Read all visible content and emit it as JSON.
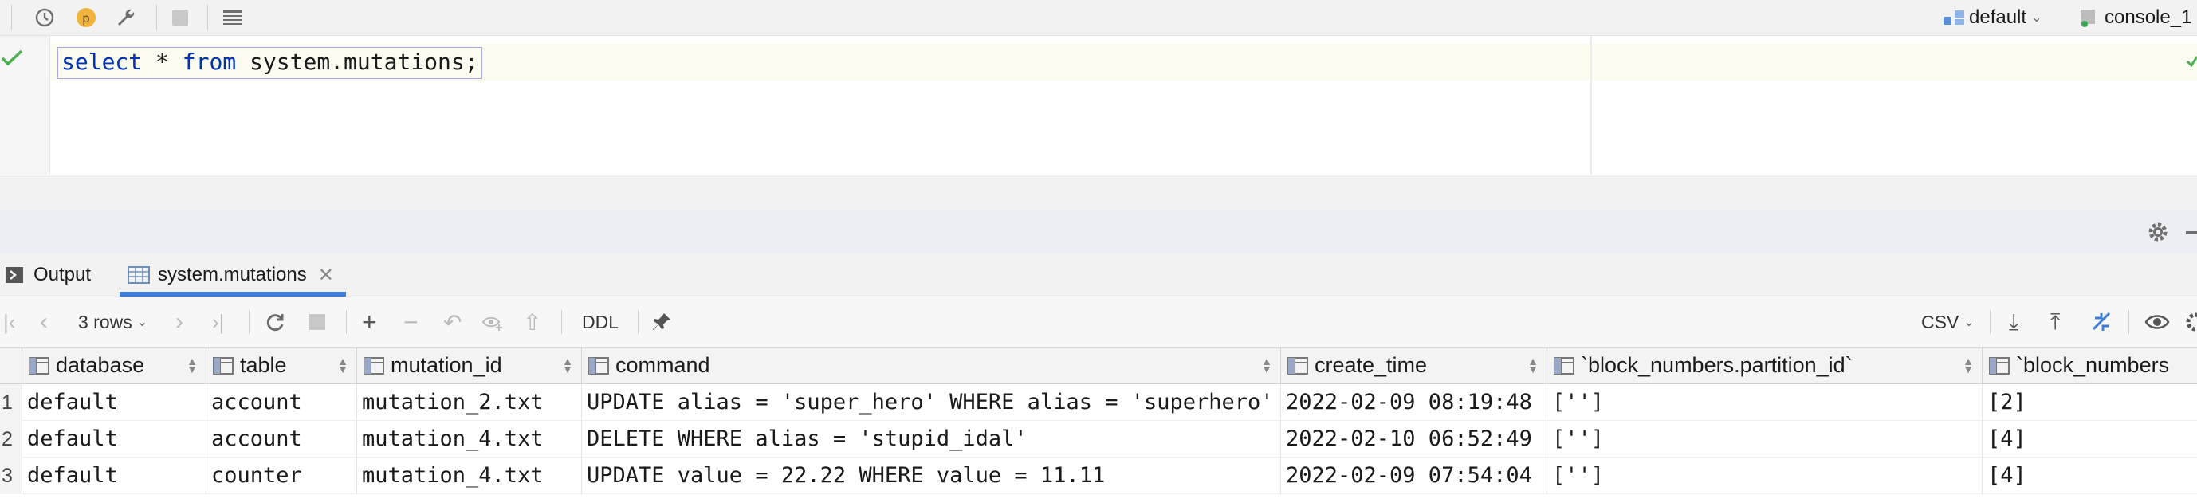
{
  "editor": {
    "kw_select": "select",
    "star": "*",
    "kw_from": "from",
    "table": "system.mutations",
    "semicolon": ";"
  },
  "toolbar": {
    "p_badge": "p",
    "schema": "default",
    "session": "console_1"
  },
  "tabs": [
    {
      "label": "Output"
    },
    {
      "label": "system.mutations"
    }
  ],
  "results_toolbar": {
    "rows": "3 rows",
    "ddl": "DDL",
    "export_format": "CSV"
  },
  "columns": [
    "database",
    "table",
    "mutation_id",
    "command",
    "create_time",
    "`block_numbers.partition_id`",
    "`block_numbers"
  ],
  "rows": [
    {
      "n": "1",
      "cells": [
        "default",
        "account",
        "mutation_2.txt",
        "UPDATE alias = 'super_hero' WHERE alias = 'superhero'",
        "2022-02-09 08:19:48",
        "['']",
        "[2]"
      ]
    },
    {
      "n": "2",
      "cells": [
        "default",
        "account",
        "mutation_4.txt",
        "DELETE WHERE alias = 'stupid_idal'",
        "2022-02-10 06:52:49",
        "['']",
        "[4]"
      ]
    },
    {
      "n": "3",
      "cells": [
        "default",
        "counter",
        "mutation_4.txt",
        "UPDATE value = 22.22 WHERE value = 11.11",
        "2022-02-09 07:54:04",
        "['']",
        "[4]"
      ]
    }
  ]
}
